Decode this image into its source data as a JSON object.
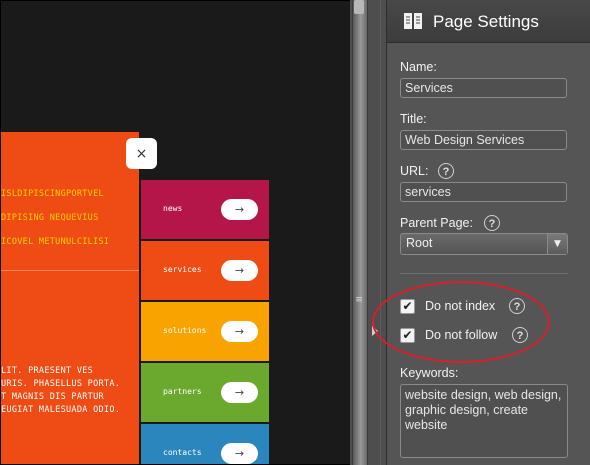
{
  "preview": {
    "close_glyph": "×",
    "orange_lines": [
      {
        "text": "ISLDIPISCINGPORTVEL",
        "color": "yellow"
      },
      {
        "text": "DIPISING NEQUEVIUS",
        "color": "yellow"
      },
      {
        "text": "ICOVEL METUNULCILISI",
        "color": "yellow"
      },
      {
        "text": "LIT. PRAESENT VES",
        "color": "white"
      },
      {
        "text": "URIS. PHASELLUS PORTA.",
        "color": "white"
      },
      {
        "text": "T MAGNIS DIS PARTUR",
        "color": "white"
      },
      {
        "text": "EUGIAT MALESUADA ODIO.",
        "color": "white"
      }
    ],
    "menu": [
      {
        "label": "news",
        "color": "#b5164a"
      },
      {
        "label": "services",
        "color": "#ef4b14"
      },
      {
        "label": "solutions",
        "color": "#f8a300"
      },
      {
        "label": "partners",
        "color": "#6aa82e"
      },
      {
        "label": "contacts",
        "color": "#2a86bd"
      }
    ],
    "arrow_glyph": "→"
  },
  "panel": {
    "title": "Page Settings",
    "name_label": "Name:",
    "name_value": "Services",
    "title_label": "Title:",
    "title_value": "Web Design Services",
    "url_label": "URL:",
    "url_value": "services",
    "parent_label": "Parent Page:",
    "parent_value": "Root",
    "help_glyph": "?",
    "do_not_index_label": "Do not index",
    "do_not_index_checked": true,
    "do_not_follow_label": "Do not follow",
    "do_not_follow_checked": true,
    "keywords_label": "Keywords:",
    "keywords_value": "website design, web design, graphic design, create website"
  },
  "colors": {
    "annotation_ellipse": "#d81f2a",
    "panel_bg": "#555555",
    "orange": "#ef4b14",
    "yellow_text": "#ffd000"
  }
}
